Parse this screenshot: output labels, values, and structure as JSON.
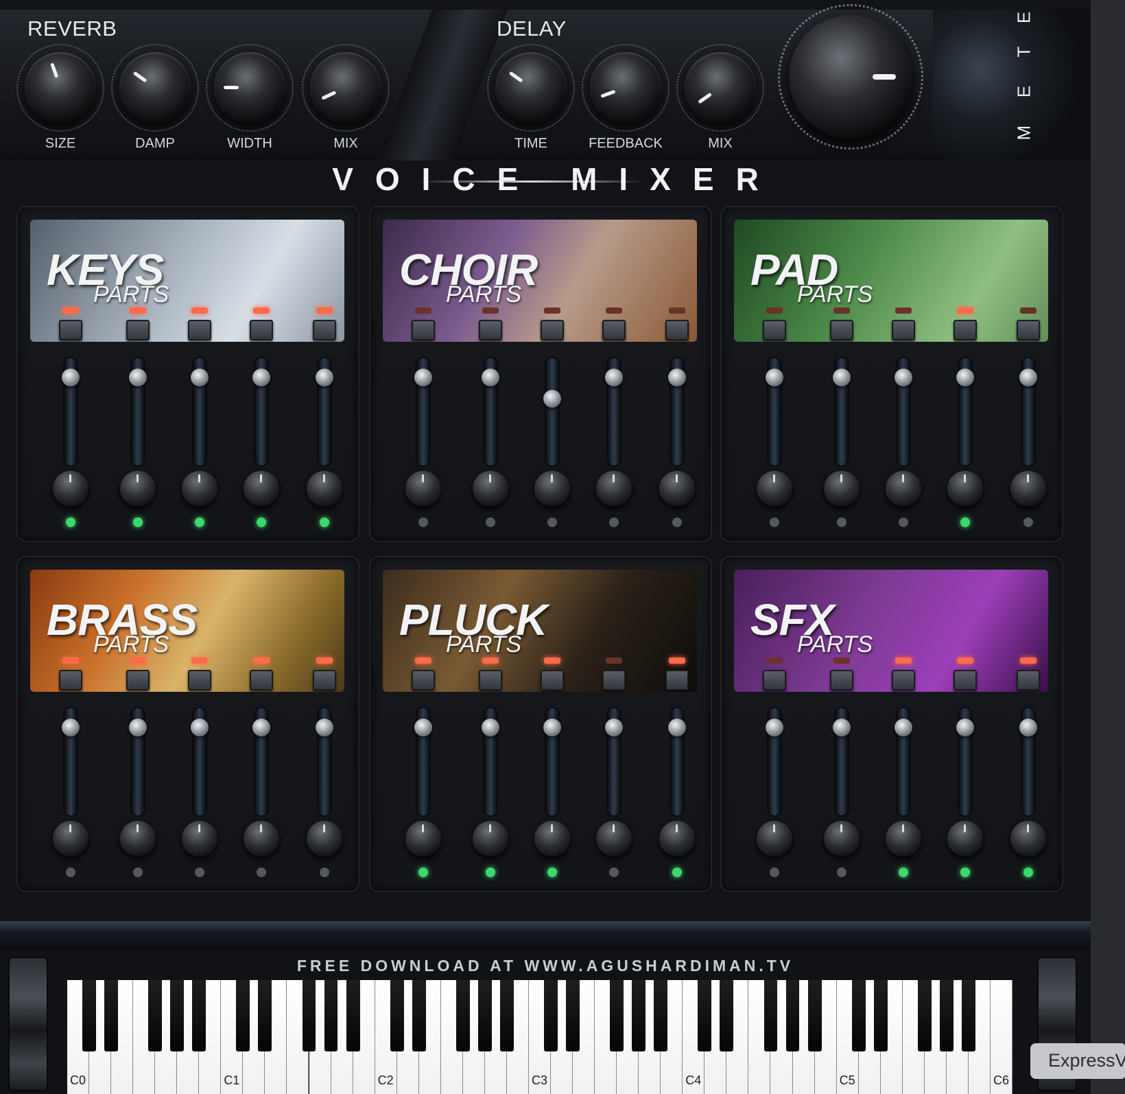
{
  "reverb": {
    "title": "REVERB",
    "knobs": [
      {
        "label": "SIZE",
        "value_deg": -20
      },
      {
        "label": "DAMP",
        "value_deg": -55
      },
      {
        "label": "WIDTH",
        "value_deg": -90
      },
      {
        "label": "MIX",
        "value_deg": -115
      }
    ]
  },
  "delay": {
    "title": "DELAY",
    "knobs": [
      {
        "label": "TIME",
        "value_deg": -55
      },
      {
        "label": "FEEDBACK",
        "value_deg": -110
      },
      {
        "label": "MIX",
        "value_deg": -125
      }
    ]
  },
  "meter_label": [
    "M",
    "E",
    "T",
    "E"
  ],
  "title": "VOICE MIXER",
  "panels": [
    {
      "name": "KEYS",
      "sub": "PARTS",
      "bg": "linear-gradient(120deg,#55606c,#a9b4bf 45%,#d7dee6 70%,#8b96a2)",
      "parts": [
        {
          "btn_on": true,
          "fader": 0.96,
          "led_on": true
        },
        {
          "btn_on": true,
          "fader": 0.96,
          "led_on": true
        },
        {
          "btn_on": true,
          "fader": 0.96,
          "led_on": true
        },
        {
          "btn_on": true,
          "fader": 0.96,
          "led_on": true
        },
        {
          "btn_on": true,
          "fader": 0.96,
          "led_on": true
        }
      ]
    },
    {
      "name": "CHOIR",
      "sub": "PARTS",
      "bg": "linear-gradient(120deg,#3c2b4a,#7b5b8e 35%,#b79b8a 60%,#8a5a36)",
      "parts": [
        {
          "btn_on": false,
          "fader": 0.96,
          "led_on": false
        },
        {
          "btn_on": false,
          "fader": 0.96,
          "led_on": false
        },
        {
          "btn_on": false,
          "fader": 0.72,
          "led_on": false
        },
        {
          "btn_on": false,
          "fader": 0.96,
          "led_on": false
        },
        {
          "btn_on": false,
          "fader": 0.96,
          "led_on": false
        }
      ]
    },
    {
      "name": "PAD",
      "sub": "PARTS",
      "bg": "linear-gradient(120deg,#1f4a22,#4d8a4a 40%,#8fbf82 75%,#5f8f55)",
      "parts": [
        {
          "btn_on": false,
          "fader": 0.96,
          "led_on": false
        },
        {
          "btn_on": false,
          "fader": 0.96,
          "led_on": false
        },
        {
          "btn_on": false,
          "fader": 0.96,
          "led_on": false
        },
        {
          "btn_on": true,
          "fader": 0.96,
          "led_on": true
        },
        {
          "btn_on": false,
          "fader": 0.96,
          "led_on": false
        }
      ]
    },
    {
      "name": "BRASS",
      "sub": "PARTS",
      "bg": "linear-gradient(120deg,#8a3a10,#c9702a 30%,#d9b46a 55%,#8a6a2a 80%,#4a3a1a)",
      "parts": [
        {
          "btn_on": true,
          "fader": 0.96,
          "led_on": false
        },
        {
          "btn_on": true,
          "fader": 0.96,
          "led_on": false
        },
        {
          "btn_on": true,
          "fader": 0.96,
          "led_on": false
        },
        {
          "btn_on": true,
          "fader": 0.96,
          "led_on": false
        },
        {
          "btn_on": true,
          "fader": 0.96,
          "led_on": false
        }
      ]
    },
    {
      "name": "PLUCK",
      "sub": "PARTS",
      "bg": "linear-gradient(120deg,#3b2c1c,#7a5a34 35%,#2a2118 65%,#0e0c0a)",
      "parts": [
        {
          "btn_on": true,
          "fader": 0.96,
          "led_on": true
        },
        {
          "btn_on": true,
          "fader": 0.96,
          "led_on": true
        },
        {
          "btn_on": true,
          "fader": 0.96,
          "led_on": true
        },
        {
          "btn_on": false,
          "fader": 0.96,
          "led_on": false
        },
        {
          "btn_on": true,
          "fader": 0.96,
          "led_on": true
        }
      ]
    },
    {
      "name": "SFX",
      "sub": "PARTS",
      "bg": "linear-gradient(120deg,#4a1f5a,#7c3a92 40%,#9c3fb8 70%,#3a0f4a)",
      "parts": [
        {
          "btn_on": false,
          "fader": 0.96,
          "led_on": false
        },
        {
          "btn_on": false,
          "fader": 0.96,
          "led_on": false
        },
        {
          "btn_on": true,
          "fader": 0.96,
          "led_on": true
        },
        {
          "btn_on": true,
          "fader": 0.96,
          "led_on": true
        },
        {
          "btn_on": true,
          "fader": 0.96,
          "led_on": true
        }
      ]
    }
  ],
  "keyboard": {
    "caption": "FREE DOWNLOAD AT WWW.AGUSHARDIMAN.TV",
    "octave_labels": [
      "C0",
      "C1",
      "C2",
      "C3",
      "C4",
      "C5",
      "C6"
    ]
  },
  "tooltip": "ExpressV"
}
